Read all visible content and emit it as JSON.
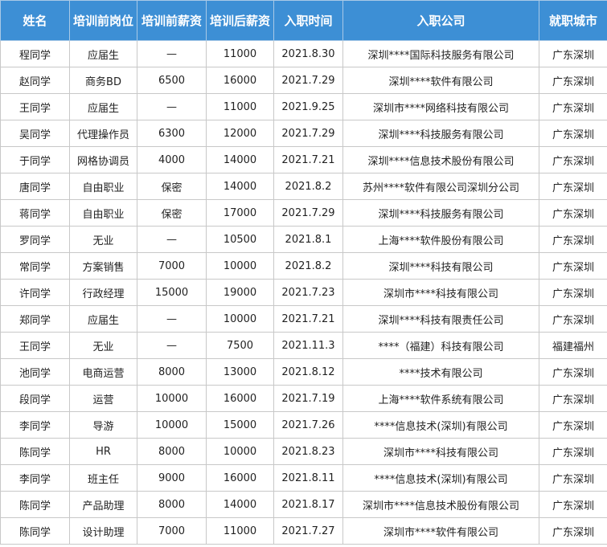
{
  "table": {
    "headers": [
      "姓名",
      "培训前岗位",
      "培训前薪资",
      "培训后薪资",
      "入职时间",
      "入职公司",
      "就职城市"
    ],
    "rows": [
      [
        "程同学",
        "应届生",
        "—",
        "11000",
        "2021.8.30",
        "深圳****国际科技服务有限公司",
        "广东深圳"
      ],
      [
        "赵同学",
        "商务BD",
        "6500",
        "16000",
        "2021.7.29",
        "深圳****软件有限公司",
        "广东深圳"
      ],
      [
        "王同学",
        "应届生",
        "—",
        "11000",
        "2021.9.25",
        "深圳市****网络科技有限公司",
        "广东深圳"
      ],
      [
        "吴同学",
        "代理操作员",
        "6300",
        "12000",
        "2021.7.29",
        "深圳****科技服务有限公司",
        "广东深圳"
      ],
      [
        "于同学",
        "网格协调员",
        "4000",
        "14000",
        "2021.7.21",
        "深圳****信息技术股份有限公司",
        "广东深圳"
      ],
      [
        "唐同学",
        "自由职业",
        "保密",
        "14000",
        "2021.8.2",
        "苏州****软件有限公司深圳分公司",
        "广东深圳"
      ],
      [
        "蒋同学",
        "自由职业",
        "保密",
        "17000",
        "2021.7.29",
        "深圳****科技服务有限公司",
        "广东深圳"
      ],
      [
        "罗同学",
        "无业",
        "—",
        "10500",
        "2021.8.1",
        "上海****软件股份有限公司",
        "广东深圳"
      ],
      [
        "常同学",
        "方案销售",
        "7000",
        "10000",
        "2021.8.2",
        "深圳****科技有限公司",
        "广东深圳"
      ],
      [
        "许同学",
        "行政经理",
        "15000",
        "19000",
        "2021.7.23",
        "深圳市****科技有限公司",
        "广东深圳"
      ],
      [
        "郑同学",
        "应届生",
        "—",
        "10000",
        "2021.7.21",
        "深圳****科技有限责任公司",
        "广东深圳"
      ],
      [
        "王同学",
        "无业",
        "—",
        "7500",
        "2021.11.3",
        "****（福建）科技有限公司",
        "福建福州"
      ],
      [
        "池同学",
        "电商运营",
        "8000",
        "13000",
        "2021.8.12",
        "****技术有限公司",
        "广东深圳"
      ],
      [
        "段同学",
        "运营",
        "10000",
        "16000",
        "2021.7.19",
        "上海****软件系统有限公司",
        "广东深圳"
      ],
      [
        "李同学",
        "导游",
        "10000",
        "15000",
        "2021.7.26",
        "****信息技术(深圳)有限公司",
        "广东深圳"
      ],
      [
        "陈同学",
        "HR",
        "8000",
        "10000",
        "2021.8.23",
        "深圳市****科技有限公司",
        "广东深圳"
      ],
      [
        "李同学",
        "班主任",
        "9000",
        "16000",
        "2021.8.11",
        "****信息技术(深圳)有限公司",
        "广东深圳"
      ],
      [
        "陈同学",
        "产品助理",
        "8000",
        "14000",
        "2021.8.17",
        "深圳市****信息技术股份有限公司",
        "广东深圳"
      ],
      [
        "陈同学",
        "设计助理",
        "7000",
        "11000",
        "2021.7.27",
        "深圳市****软件有限公司",
        "广东深圳"
      ]
    ]
  }
}
